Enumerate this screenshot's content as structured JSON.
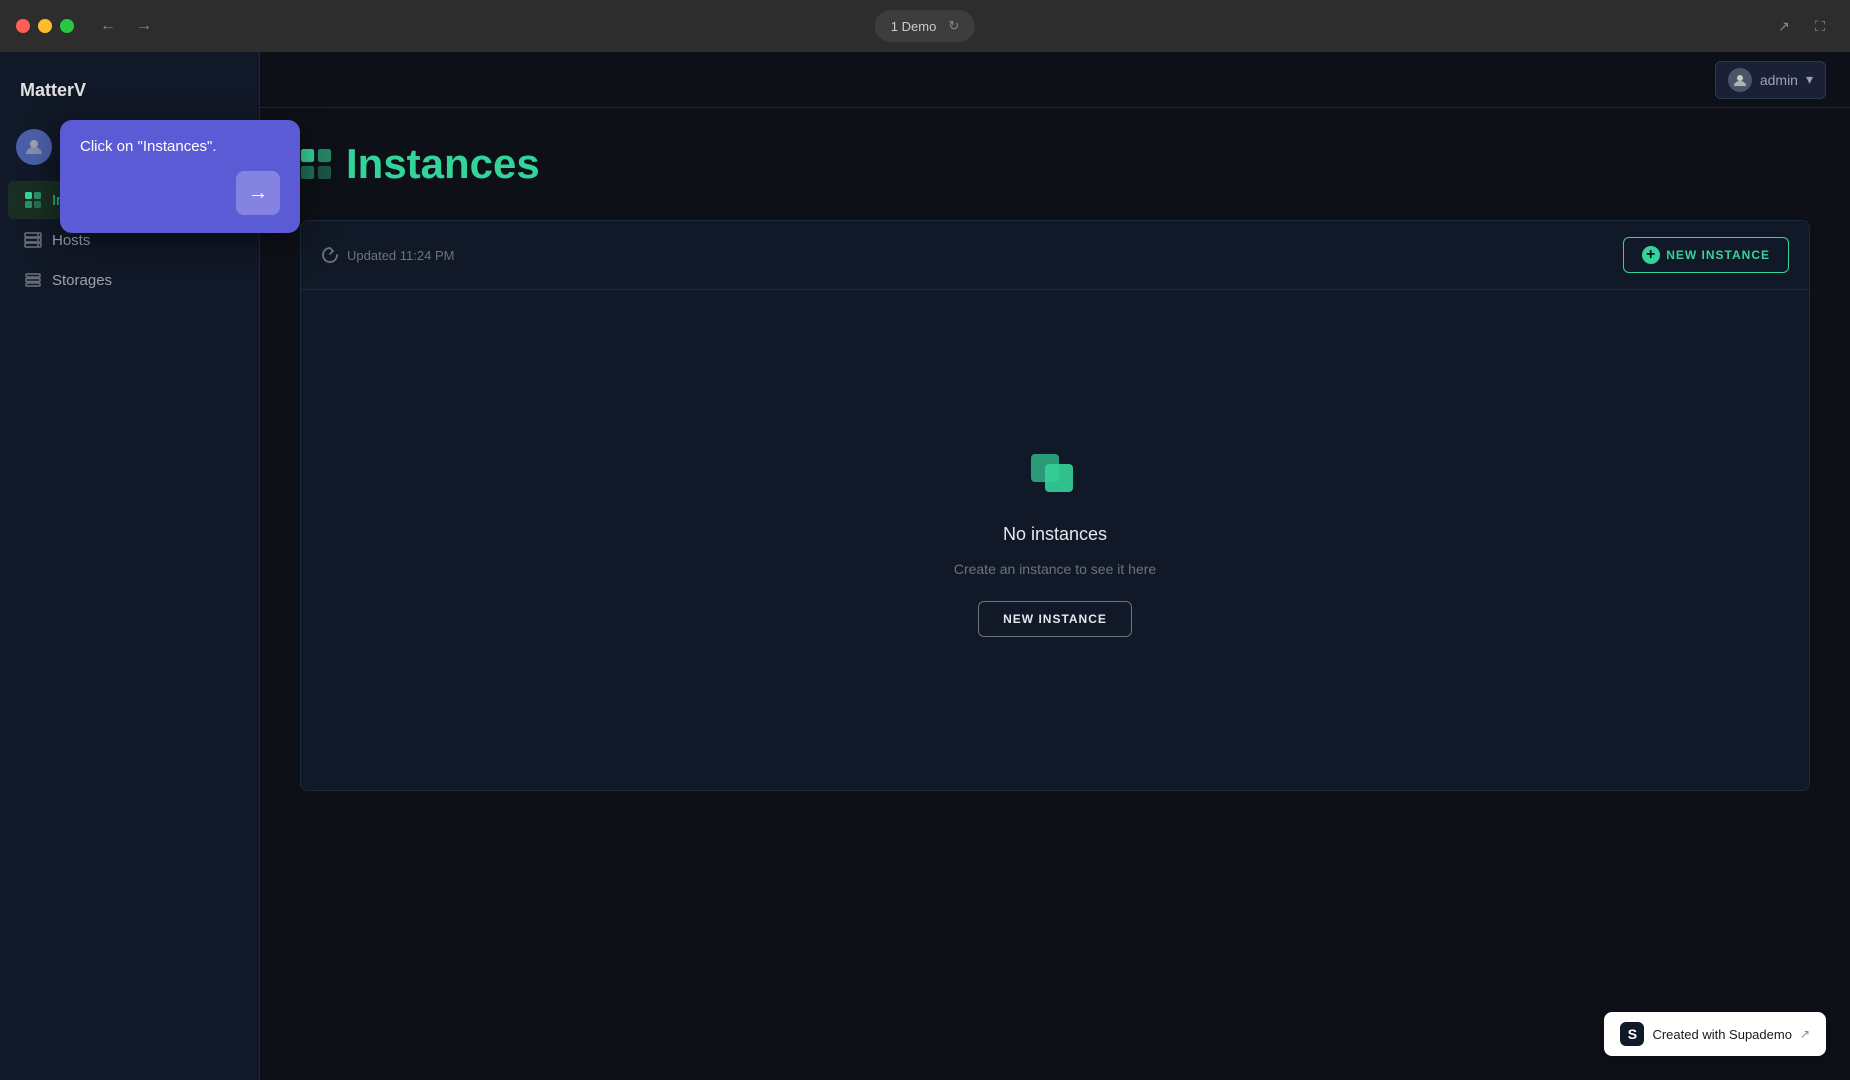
{
  "browser": {
    "tab_title": "1 Demo",
    "nav_back": "←",
    "nav_forward": "→",
    "refresh_icon": "↻",
    "share_icon": "↗",
    "fullscreen_icon": "⛶"
  },
  "sidebar": {
    "logo": "MatterV",
    "items": [
      {
        "id": "instances",
        "label": "Instances",
        "active": true
      },
      {
        "id": "hosts",
        "label": "Hosts",
        "active": false
      },
      {
        "id": "storages",
        "label": "Storages",
        "active": false
      }
    ]
  },
  "topbar": {
    "admin_label": "admin",
    "admin_caret": "▾"
  },
  "page": {
    "title": "Instances",
    "updated_text": "Updated 11:24 PM",
    "new_instance_btn": "NEW INSTANCE",
    "empty_title": "No instances",
    "empty_subtitle": "Create an instance to see it here",
    "empty_btn": "NEW INSTANCE"
  },
  "tooltip": {
    "message": "Click on \"Instances\".",
    "arrow": "→"
  },
  "supademo": {
    "label": "Created with Supademo",
    "arrow": "↗"
  }
}
